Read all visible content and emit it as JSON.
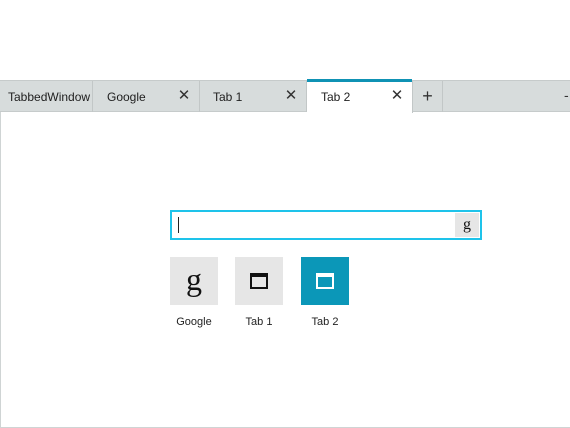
{
  "tabs": [
    {
      "label": "TabbedWindow",
      "closable": false
    },
    {
      "label": "Google",
      "closable": true,
      "close": "✕"
    },
    {
      "label": "Tab 1",
      "closable": true,
      "close": "✕"
    },
    {
      "label": "Tab 2",
      "closable": true,
      "close": "✕",
      "active": true
    }
  ],
  "new_tab": {
    "label": "+"
  },
  "overflow": {
    "label": "-"
  },
  "search": {
    "value": "",
    "button_glyph": "g",
    "border_color": "#1ec3ea"
  },
  "tiles": [
    {
      "label": "Google",
      "icon": "google-g-icon",
      "glyph": "g",
      "color": "#e6e6e6"
    },
    {
      "label": "Tab 1",
      "icon": "window-icon",
      "color": "#e6e6e6"
    },
    {
      "label": "Tab 2",
      "icon": "window-icon",
      "color": "#0b97b8",
      "selected": true
    }
  ],
  "colors": {
    "accent": "#0f92b4",
    "tabbar": "#d7dcdc"
  }
}
